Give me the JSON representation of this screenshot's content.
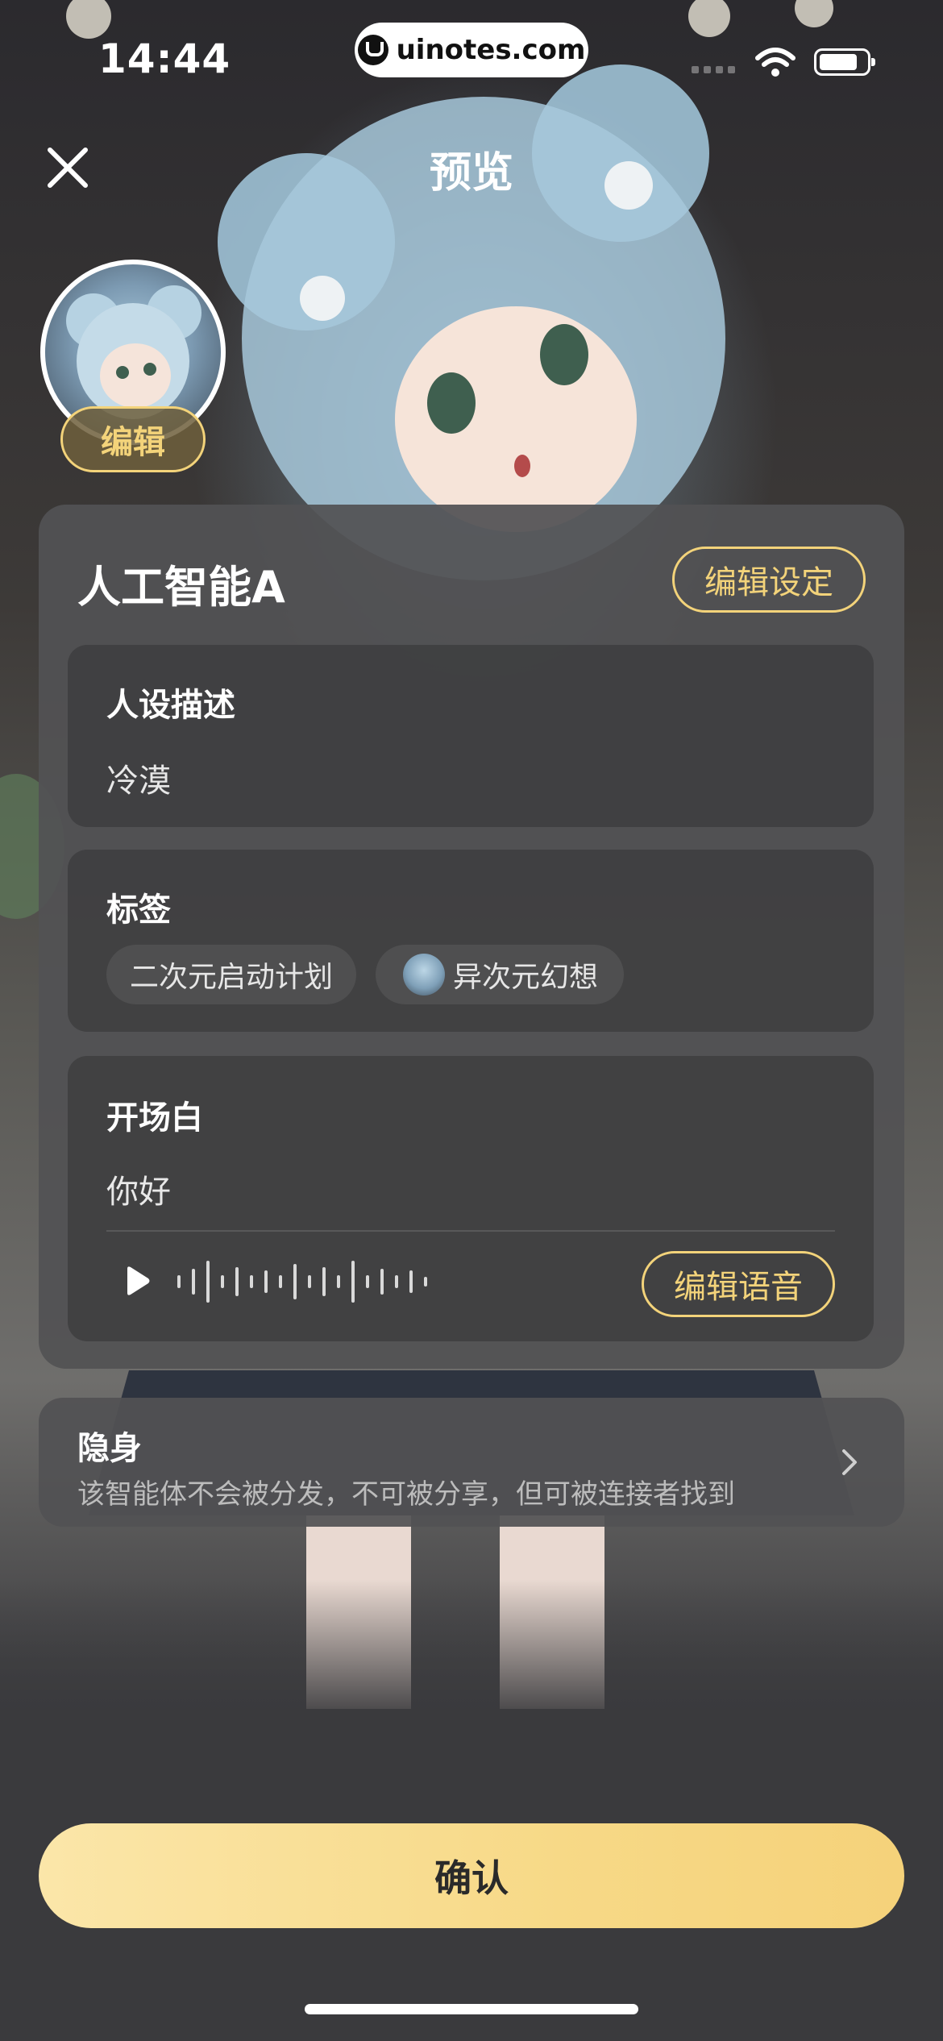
{
  "status_bar": {
    "time": "14:44",
    "url": "uinotes.com"
  },
  "header": {
    "title": "预览",
    "close_icon": "close-icon"
  },
  "avatar": {
    "edit_label": "编辑"
  },
  "profile": {
    "name": "人工智能A",
    "edit_settings_label": "编辑设定",
    "persona": {
      "label": "人设描述",
      "value": "冷漠"
    },
    "tags": {
      "label": "标签",
      "items": [
        "二次元启动计划",
        "异次元幻想"
      ]
    },
    "opening": {
      "label": "开场白",
      "value": "你好",
      "edit_voice_label": "编辑语音",
      "play_icon": "play-icon"
    }
  },
  "stealth": {
    "title": "隐身",
    "description": "该智能体不会被分发，不可被分享，但可被连接者找到",
    "chevron_icon": "chevron-right-icon"
  },
  "confirm_label": "确认",
  "colors": {
    "accent": "#f3d37a",
    "confirm_bg": "#f7d987",
    "card_bg": "#525254"
  }
}
